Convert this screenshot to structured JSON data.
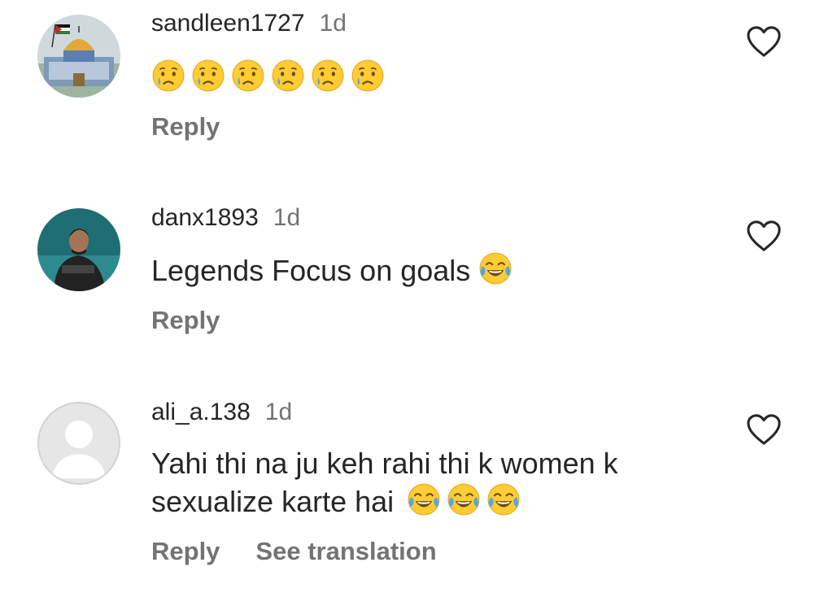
{
  "comments": [
    {
      "username": "sandleen1727",
      "time": "1d",
      "text": "",
      "emojis": [
        "crying-face",
        "crying-face",
        "crying-face",
        "crying-face",
        "crying-face",
        "crying-face"
      ],
      "reply_label": "Reply"
    },
    {
      "username": "danx1893",
      "time": "1d",
      "text": "Legends Focus on goals",
      "emojis": [
        "tears-of-joy-face"
      ],
      "reply_label": "Reply"
    },
    {
      "username": "ali_a.138",
      "time": "1d",
      "text_line1": "Yahi thi na ju keh rahi thi k women k",
      "text_line2": "sexualize karte hai",
      "emojis": [
        "tears-of-joy-face",
        "tears-of-joy-face",
        "tears-of-joy-face"
      ],
      "reply_label": "Reply",
      "translate_label": "See translation"
    }
  ],
  "colors": {
    "text": "#262626",
    "muted": "#737373",
    "emoji": "#FFCC33"
  },
  "icons": [
    "heart-icon",
    "crying-face",
    "tears-of-joy-face"
  ]
}
